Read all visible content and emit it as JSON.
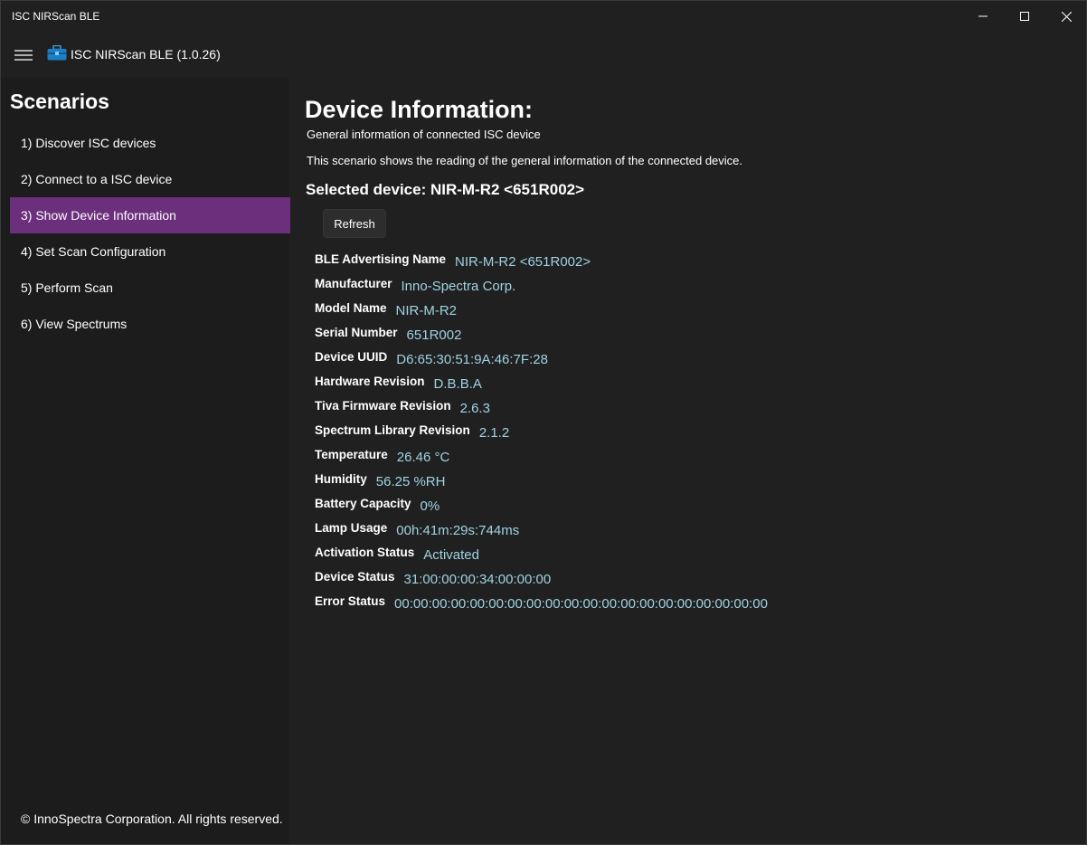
{
  "window": {
    "title": "ISC NIRScan BLE"
  },
  "appbar": {
    "name": "ISC NIRScan BLE (1.0.26)"
  },
  "sidebar": {
    "heading": "Scenarios",
    "items": [
      {
        "label": "1) Discover ISC devices",
        "selected": false
      },
      {
        "label": "2) Connect to a ISC device",
        "selected": false
      },
      {
        "label": "3) Show Device Information",
        "selected": true
      },
      {
        "label": "4) Set Scan Configuration",
        "selected": false
      },
      {
        "label": "5) Perform Scan",
        "selected": false
      },
      {
        "label": "6) View Spectrums",
        "selected": false
      }
    ],
    "footer": "© InnoSpectra Corporation. All rights reserved."
  },
  "main": {
    "title": "Device Information:",
    "subtitle": "General information of connected ISC device",
    "description": "This scenario shows the reading of the general information of the connected device.",
    "selected_device": "Selected device: NIR-M-R2 <651R002>",
    "refresh_label": "Refresh",
    "info": [
      {
        "label": "BLE Advertising Name",
        "value": "NIR-M-R2 <651R002>"
      },
      {
        "label": "Manufacturer",
        "value": "Inno-Spectra Corp."
      },
      {
        "label": "Model Name",
        "value": "NIR-M-R2"
      },
      {
        "label": "Serial Number",
        "value": "651R002"
      },
      {
        "label": "Device UUID",
        "value": "D6:65:30:51:9A:46:7F:28"
      },
      {
        "label": "Hardware Revision",
        "value": "D.B.B.A"
      },
      {
        "label": "Tiva Firmware Revision",
        "value": "2.6.3"
      },
      {
        "label": "Spectrum Library Revision",
        "value": "2.1.2"
      },
      {
        "label": "Temperature",
        "value": "26.46 °C"
      },
      {
        "label": "Humidity",
        "value": "56.25 %RH"
      },
      {
        "label": "Battery Capacity",
        "value": "0%"
      },
      {
        "label": "Lamp Usage",
        "value": "00h:41m:29s:744ms"
      },
      {
        "label": "Activation Status",
        "value": "Activated"
      },
      {
        "label": "Device Status",
        "value": "31:00:00:00:34:00:00:00"
      },
      {
        "label": "Error Status",
        "value": "00:00:00:00:00:00:00:00:00:00:00:00:00:00:00:00:00:00:00:00"
      }
    ]
  },
  "colors": {
    "accent_selected": "#6b2f7c",
    "value_text": "#9fd3e3",
    "background": "#202020",
    "sidebar_background": "#1c1c1c"
  }
}
